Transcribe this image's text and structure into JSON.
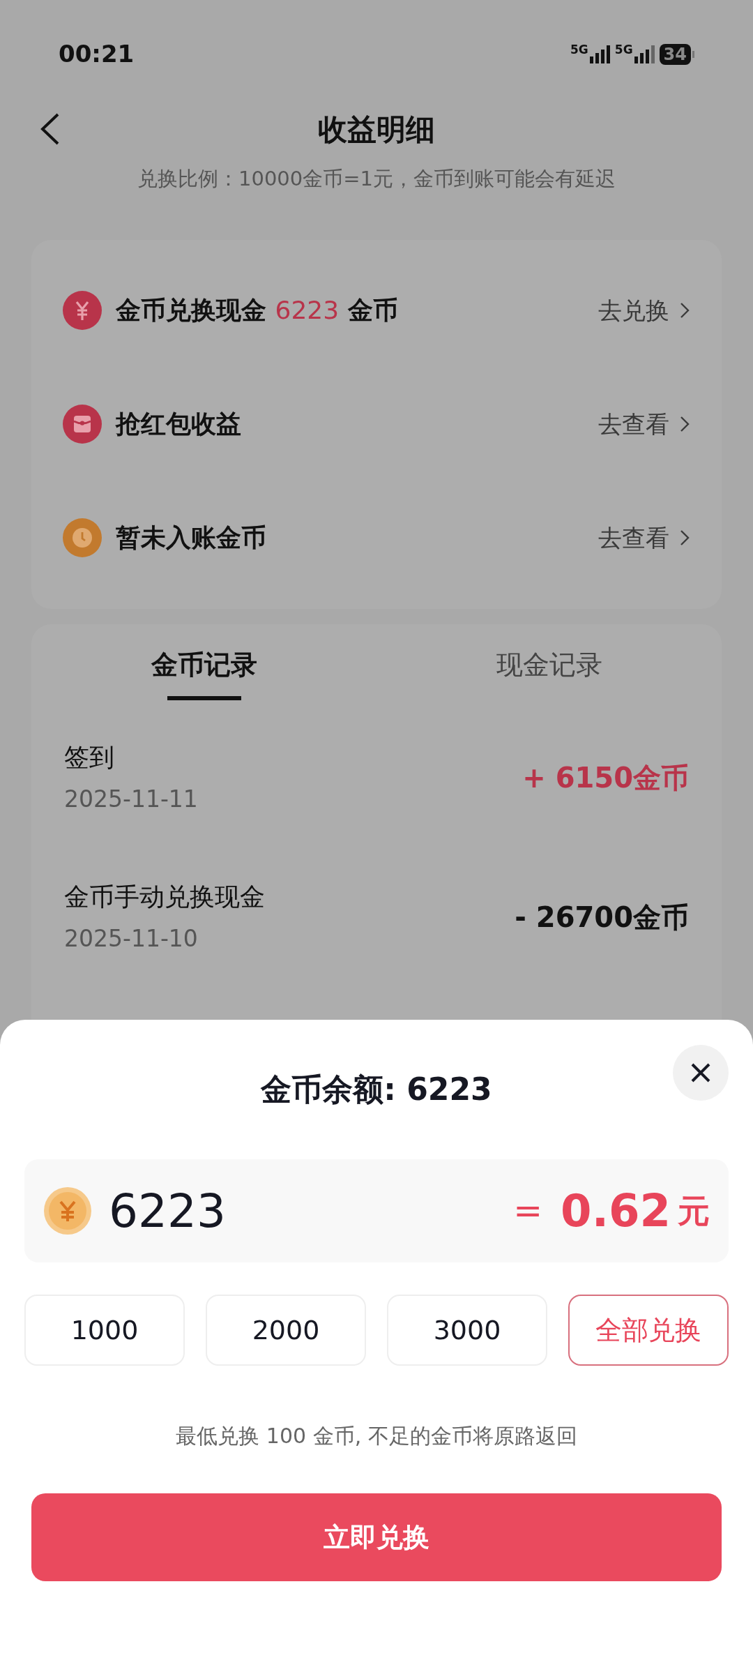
{
  "status_bar": {
    "time": "00:21",
    "network": [
      "5G",
      "5G"
    ],
    "battery": "34"
  },
  "header": {
    "title": "收益明细",
    "subtitle": "兑换比例：10000金币=1元，金币到账可能会有延迟"
  },
  "menu": [
    {
      "kind": "coin",
      "color": "#b8344a",
      "label": "金币兑换现金",
      "amount": "6223",
      "unit": "金币",
      "action": "去兑换"
    },
    {
      "kind": "packet",
      "color": "#b8344a",
      "label": "抢红包收益",
      "action": "去查看"
    },
    {
      "kind": "clock",
      "color": "#c27a2e",
      "label": "暂未入账金币",
      "action": "去查看"
    }
  ],
  "tabs": [
    {
      "label": "金币记录",
      "selected": true
    },
    {
      "label": "现金记录",
      "selected": false
    }
  ],
  "records": [
    {
      "title": "签到",
      "date": "2025-11-11",
      "amount": "+ 6150金币",
      "kind": "income"
    },
    {
      "title": "金币手动兑换现金",
      "date": "2025-11-10",
      "amount": "- 26700金币",
      "kind": "expense"
    }
  ],
  "sheet": {
    "title": "金币余额: 6223",
    "input": "6223",
    "equals": "=",
    "cash": "0.62",
    "cash_unit": "元",
    "options": [
      {
        "label": "1000",
        "kind": "amount"
      },
      {
        "label": "2000",
        "kind": "amount"
      },
      {
        "label": "3000",
        "kind": "amount"
      },
      {
        "label": "全部兑换",
        "kind": "all"
      }
    ],
    "note": "最低兑换 100 金币, 不足的金币将原路返回",
    "submit": "立即兑换"
  }
}
